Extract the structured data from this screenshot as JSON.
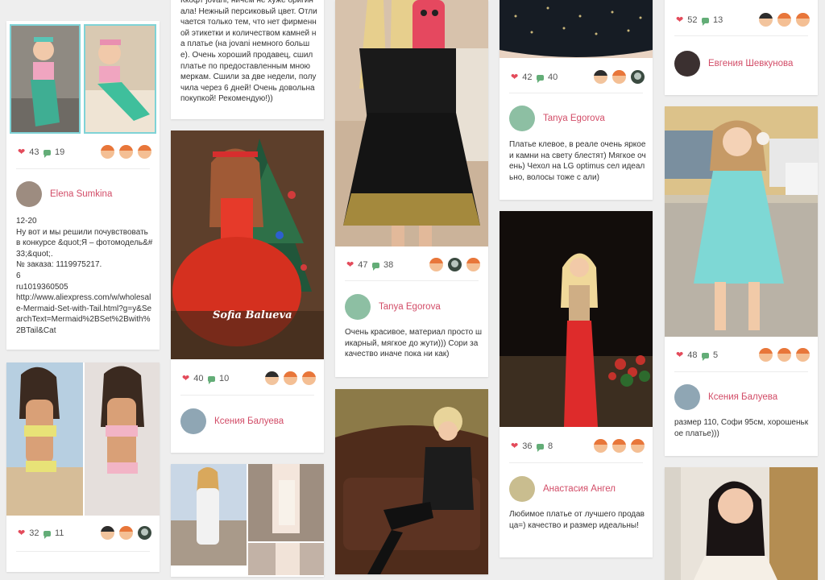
{
  "colors": {
    "background": "#eeeeee",
    "card": "#ffffff",
    "username": "#d24c67",
    "heart": "#e34b5b",
    "comment": "#63ad77"
  },
  "columns": [
    {
      "cards": [
        {
          "likes": "43",
          "comments": "19",
          "voters": [
            "light",
            "light",
            "light"
          ],
          "user": "Elena Sumkina",
          "description": "12-20\nНу вот и мы решили почувствовать в конкурсе &quot;Я – фотомодель&#33;&quot;.\n№ заказа: 1119975217.\n6\nru1019360505\nhttp://www.aliexpress.com/w/wholesale-Mermaid-Set-with-Tail.html?g=y&SearchText=Mermaid%2BSet%2Bwith%2BTail&Cat"
        },
        {
          "likes": "32",
          "comments": "11",
          "voters": [
            "dark",
            "light",
            "photo"
          ]
        }
      ]
    },
    {
      "cards": [
        {
          "description": "Ккофт jovani, ничем не хуже оригинала! Нежный персиковый цвет. Отличается только тем, что нет фирменной этикетки и количеством камней на платье (на jovani немного больше). Очень хороший продавец, сшил платье по предоставленным мною меркам. Сшили за две недели, получила через 6 дней! Очень довольна покупкой! Рекомендую!))"
        },
        {
          "photo_caption": "Sofia Balueva",
          "likes": "40",
          "comments": "10",
          "voters": [
            "dark",
            "light",
            "light"
          ],
          "user": "Ксения Балуева"
        },
        {}
      ]
    },
    {
      "cards": [
        {
          "likes": "47",
          "comments": "38",
          "voters": [
            "light",
            "photo",
            "light"
          ],
          "user": "Tanya Egorova",
          "description": "Очень красивое, материал просто шикарный, мягкое до жути))) Сори за качество иначе пока ни как)"
        },
        {}
      ]
    },
    {
      "cards": [
        {
          "likes": "42",
          "comments": "40",
          "voters": [
            "dark",
            "light",
            "photo"
          ],
          "user": "Tanya Egorova",
          "description": "Платье клевое, в реале очень яркое и камни на свету блестят) Мягкое очень) Чехол на LG optimus сел идеально, волосы тоже с али)"
        },
        {
          "likes": "36",
          "comments": "8",
          "voters": [
            "light",
            "light",
            "light"
          ],
          "user": "Анастасия Ангел",
          "description": "Любимое платье от лучшего продавца=) качество и размер идеальны!"
        }
      ]
    },
    {
      "cards": [
        {
          "likes": "52",
          "comments": "13",
          "voters": [
            "dark",
            "light",
            "light"
          ],
          "user": "Евгения Шевкунова"
        },
        {
          "likes": "48",
          "comments": "5",
          "voters": [
            "light",
            "light",
            "light"
          ],
          "user": "Ксения Балуева",
          "description": "размер 110, Софи 95см, хорошенькое платье)))"
        },
        {}
      ]
    }
  ]
}
